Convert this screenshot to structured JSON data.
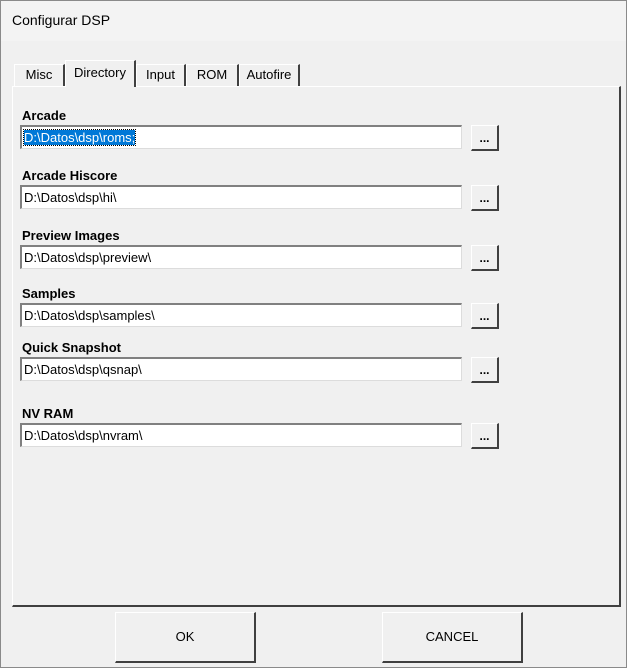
{
  "window": {
    "title": "Configurar DSP"
  },
  "tabs": [
    "Misc",
    "Directory",
    "Input",
    "ROM",
    "Autofire"
  ],
  "active_tab": "Directory",
  "fields": [
    {
      "label": "Arcade",
      "value": "D:\\Datos\\dsp\\roms;",
      "selected": true
    },
    {
      "label": "Arcade Hiscore",
      "value": "D:\\Datos\\dsp\\hi\\"
    },
    {
      "label": "Preview Images",
      "value": "D:\\Datos\\dsp\\preview\\"
    },
    {
      "label": "Samples",
      "value": "D:\\Datos\\dsp\\samples\\"
    },
    {
      "label": "Quick Snapshot",
      "value": "D:\\Datos\\dsp\\qsnap\\"
    },
    {
      "label": "NV RAM",
      "value": "D:\\Datos\\dsp\\nvram\\"
    }
  ],
  "browse_label": "...",
  "buttons": {
    "ok": "OK",
    "cancel": "CANCEL"
  }
}
